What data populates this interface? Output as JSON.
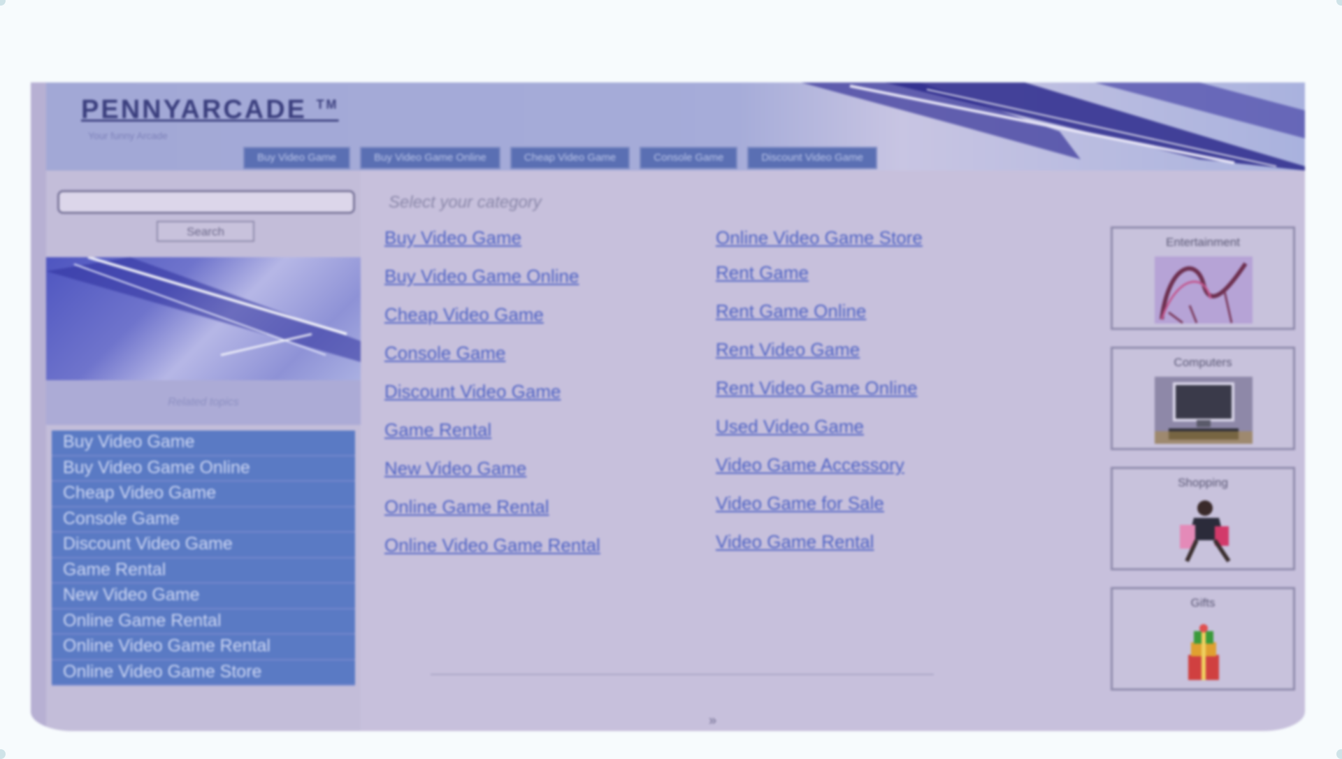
{
  "header": {
    "logo": "PENNYARCADE",
    "trademark": "TM",
    "tagline": "Your funny Arcade",
    "tabs": [
      "Buy Video Game",
      "Buy Video Game Online",
      "Cheap Video Game",
      "Console Game",
      "Discount Video Game"
    ]
  },
  "search": {
    "input_value": "",
    "button_label": "Search"
  },
  "sidebar": {
    "related_label": "Related topics",
    "items": [
      "Buy Video Game",
      "Buy Video Game Online",
      "Cheap Video Game",
      "Console Game",
      "Discount Video Game",
      "Game Rental",
      "New Video Game",
      "Online Game Rental",
      "Online Video Game Rental",
      "Online Video Game Store"
    ]
  },
  "main": {
    "select_label": "Select your category",
    "column1": [
      "Buy Video Game",
      "Buy Video Game Online",
      "Cheap Video Game",
      "Console Game",
      "Discount Video Game",
      "Game Rental",
      "New Video Game",
      "Online Game Rental",
      "Online Video Game Rental"
    ],
    "column2": [
      "Online Video Game Store",
      "Rent Game",
      "Rent Game Online",
      "Rent Video Game",
      "Rent Video Game Online",
      "Used Video Game",
      "Video Game Accessory",
      "Video Game for Sale",
      "Video Game Rental"
    ],
    "footer_mark": "»"
  },
  "categories": [
    {
      "label": "Entertainment",
      "icon": "roller-coaster-icon"
    },
    {
      "label": "Computers",
      "icon": "computer-icon"
    },
    {
      "label": "Shopping",
      "icon": "shopper-icon"
    },
    {
      "label": "Gifts",
      "icon": "gift-icon"
    }
  ],
  "colors": {
    "header_bg": "#a2a8d6",
    "tab_bg": "#5a6fb3",
    "nav_bg": "#5a7ac4",
    "link": "#4d61c4",
    "page_bg": "#c7c0dc"
  }
}
